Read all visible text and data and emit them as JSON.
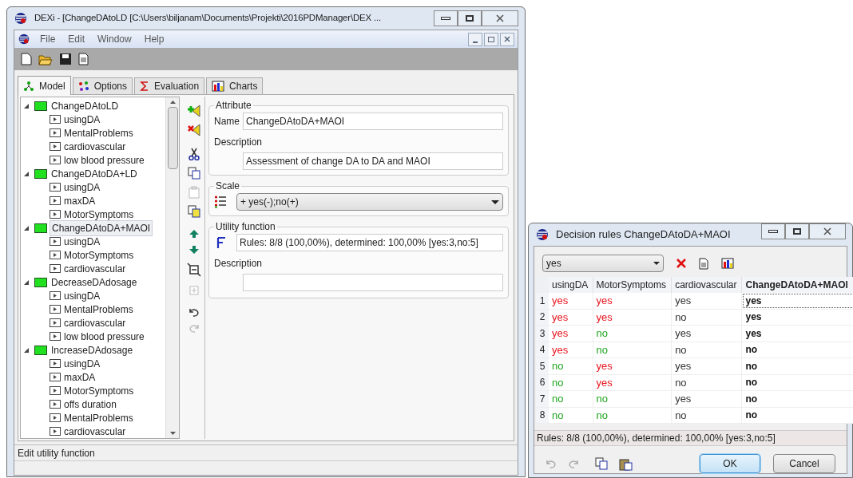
{
  "main_window": {
    "title": "DEXi - [ChangeDAtoLD [C:\\Users\\biljanam\\Documents\\Projekti\\2016PDManager\\DEX ...",
    "menu": [
      "File",
      "Edit",
      "Window",
      "Help"
    ],
    "tabs": [
      {
        "label": "Model",
        "selected": true
      },
      {
        "label": "Options",
        "selected": false
      },
      {
        "label": "Evaluation",
        "selected": false
      },
      {
        "label": "Charts",
        "selected": false
      }
    ],
    "tree": [
      {
        "label": "ChangeDAtoLD",
        "selected": false,
        "expanded": true,
        "children": [
          {
            "label": "usingDA"
          },
          {
            "label": "MentalProblems"
          },
          {
            "label": "cardiovascular"
          },
          {
            "label": "low blood pressure"
          }
        ]
      },
      {
        "label": "ChangeDAtoDA+LD",
        "selected": false,
        "expanded": true,
        "children": [
          {
            "label": "usingDA"
          },
          {
            "label": "maxDA"
          },
          {
            "label": "MotorSymptoms"
          }
        ]
      },
      {
        "label": "ChangeDAtoDA+MAOI",
        "selected": true,
        "expanded": true,
        "children": [
          {
            "label": "usingDA"
          },
          {
            "label": "MotorSymptoms"
          },
          {
            "label": "cardiovascular"
          }
        ]
      },
      {
        "label": "DecreaseDAdosage",
        "selected": false,
        "expanded": true,
        "children": [
          {
            "label": "usingDA"
          },
          {
            "label": "MentalProblems"
          },
          {
            "label": "cardiovascular"
          },
          {
            "label": "low blood pressure"
          }
        ]
      },
      {
        "label": "IncreaseDAdosage",
        "selected": false,
        "expanded": true,
        "children": [
          {
            "label": "usingDA"
          },
          {
            "label": "maxDA"
          },
          {
            "label": "MotorSymptoms"
          },
          {
            "label": "offs duration"
          },
          {
            "label": "MentalProblems"
          },
          {
            "label": "cardiovascular"
          }
        ]
      }
    ],
    "attribute": {
      "heading": "Attribute",
      "name_label": "Name",
      "name_value": "ChangeDAtoDA+MAOI",
      "description_label": "Description",
      "description_value": "Assessment of change DA to DA and MAOI"
    },
    "scale": {
      "heading": "Scale",
      "value": "+ yes(-);no(+)"
    },
    "utility": {
      "heading": "Utility function",
      "value": "Rules: 8/8 (100,00%), determined: 100,00% [yes:3,no:5]",
      "description_label": "Description"
    },
    "status_bar": "Edit utility function"
  },
  "dialog": {
    "title": "Decision rules ChangeDAtoDA+MAOI",
    "filter": "yes",
    "columns": [
      {
        "label": "usingDA",
        "kind": "input"
      },
      {
        "label": "MotorSymptoms",
        "kind": "input"
      },
      {
        "label": "cardiovascular",
        "kind": "input"
      },
      {
        "label": "ChangeDAtoDA+MAOI",
        "kind": "output"
      }
    ],
    "rows": [
      {
        "number": "1",
        "selected": true,
        "cells": [
          {
            "text": "yes",
            "color": "#e8141e"
          },
          {
            "text": "yes",
            "color": "#e8141e"
          },
          {
            "text": "yes",
            "color": "#333333"
          },
          {
            "text": "yes",
            "color": "#111111"
          }
        ]
      },
      {
        "number": "2",
        "selected": false,
        "cells": [
          {
            "text": "yes",
            "color": "#e8141e"
          },
          {
            "text": "yes",
            "color": "#e8141e"
          },
          {
            "text": "no",
            "color": "#333333"
          },
          {
            "text": "yes",
            "color": "#111111"
          }
        ]
      },
      {
        "number": "3",
        "selected": false,
        "cells": [
          {
            "text": "yes",
            "color": "#e8141e"
          },
          {
            "text": "no",
            "color": "#1fa51f"
          },
          {
            "text": "yes",
            "color": "#333333"
          },
          {
            "text": "yes",
            "color": "#111111"
          }
        ]
      },
      {
        "number": "4",
        "selected": false,
        "cells": [
          {
            "text": "yes",
            "color": "#e8141e"
          },
          {
            "text": "no",
            "color": "#1fa51f"
          },
          {
            "text": "no",
            "color": "#333333"
          },
          {
            "text": "no",
            "color": "#111111"
          }
        ]
      },
      {
        "number": "5",
        "selected": false,
        "cells": [
          {
            "text": "no",
            "color": "#1fa51f"
          },
          {
            "text": "yes",
            "color": "#e8141e"
          },
          {
            "text": "yes",
            "color": "#333333"
          },
          {
            "text": "no",
            "color": "#111111"
          }
        ]
      },
      {
        "number": "6",
        "selected": false,
        "cells": [
          {
            "text": "no",
            "color": "#1fa51f"
          },
          {
            "text": "yes",
            "color": "#e8141e"
          },
          {
            "text": "no",
            "color": "#333333"
          },
          {
            "text": "no",
            "color": "#111111"
          }
        ]
      },
      {
        "number": "7",
        "selected": false,
        "cells": [
          {
            "text": "no",
            "color": "#1fa51f"
          },
          {
            "text": "no",
            "color": "#1fa51f"
          },
          {
            "text": "yes",
            "color": "#333333"
          },
          {
            "text": "no",
            "color": "#111111"
          }
        ]
      },
      {
        "number": "8",
        "selected": false,
        "cells": [
          {
            "text": "no",
            "color": "#1fa51f"
          },
          {
            "text": "no",
            "color": "#1fa51f"
          },
          {
            "text": "no",
            "color": "#333333"
          },
          {
            "text": "no",
            "color": "#111111"
          }
        ]
      }
    ],
    "status": "Rules: 8/8 (100,00%), determined: 100,00% [yes:3,no:5]",
    "buttons": [
      "OK",
      "Cancel"
    ]
  }
}
